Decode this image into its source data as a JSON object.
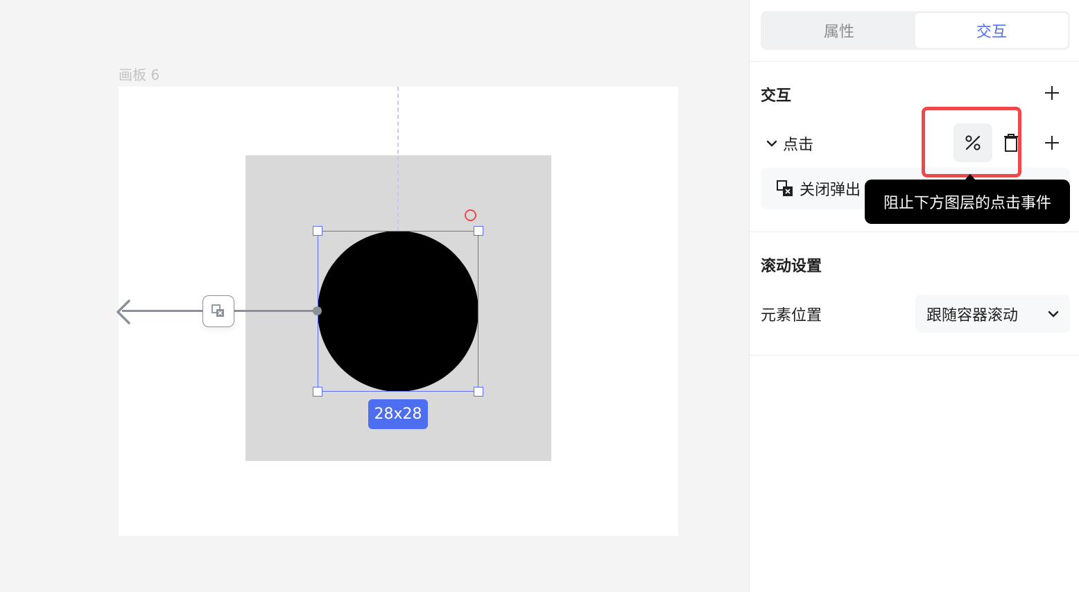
{
  "canvas": {
    "artboard_label": "画板 6",
    "size_badge": "28x28"
  },
  "panel": {
    "tabs": [
      {
        "label": "属性",
        "active": false
      },
      {
        "label": "交互",
        "active": true
      }
    ],
    "interaction": {
      "title": "交互",
      "trigger": "点击",
      "action": "关闭弹出",
      "tooltip": "阻止下方图层的点击事件"
    },
    "scroll": {
      "title": "滚动设置",
      "field_label": "元素位置",
      "select_value": "跟随容器滚动"
    }
  },
  "colors": {
    "accent": "#4e6ef2",
    "highlight": "#f04848",
    "selection": "#5b6ef5"
  },
  "icons": [
    "plus-icon",
    "chevron-down-icon",
    "stop-propagation-icon",
    "trash-icon",
    "close-popup-icon",
    "arrow-left-icon"
  ]
}
